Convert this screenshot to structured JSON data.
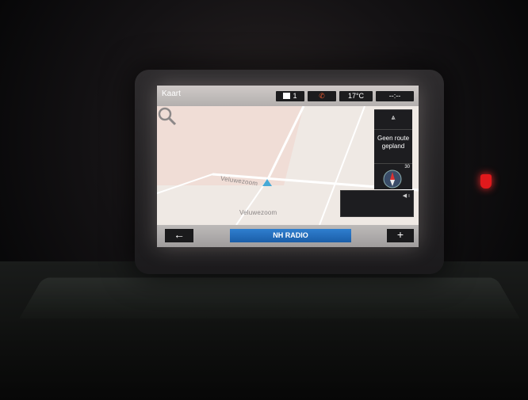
{
  "screen": {
    "title": "Kaart",
    "status": {
      "phone_count": "1",
      "temperature": "17°C",
      "clock": "--:--"
    },
    "map": {
      "road_label_1": "Veluwezoom",
      "road_label_2": "Veluwezoom"
    },
    "side_panel": {
      "route_label": "Geen route gepland",
      "compass_scale": "30"
    },
    "bottom": {
      "back_label": "←",
      "radio_label": "NH RADIO",
      "plus_label": "+"
    }
  },
  "colors": {
    "screen_bg": "#e9e2dc",
    "radio_button": "#2f7fcf",
    "position_marker": "#47a9d6",
    "hazard_light": "#e0191c"
  }
}
